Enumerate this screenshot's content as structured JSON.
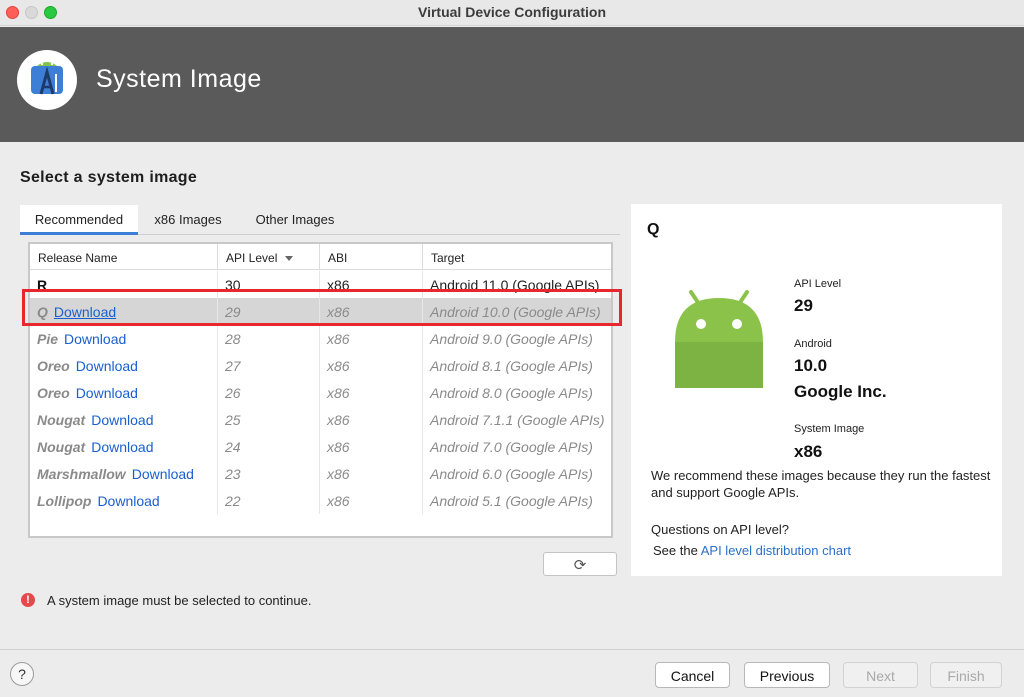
{
  "window": {
    "title": "Virtual Device Configuration"
  },
  "header": {
    "title": "System Image",
    "logo_icon": "android-studio-icon"
  },
  "section": {
    "title": "Select a system image"
  },
  "tabs": [
    {
      "label": "Recommended",
      "active": true
    },
    {
      "label": "x86 Images",
      "active": false
    },
    {
      "label": "Other Images",
      "active": false
    }
  ],
  "table": {
    "columns": [
      "Release Name",
      "API Level",
      "ABI",
      "Target"
    ],
    "sort_column": "API Level",
    "rows": [
      {
        "name": "R",
        "download": "",
        "api": "30",
        "abi": "x86",
        "target": "Android 11.0 (Google APIs)",
        "installed": true,
        "selected": false
      },
      {
        "name": "Q",
        "download": "Download",
        "api": "29",
        "abi": "x86",
        "target": "Android 10.0 (Google APIs)",
        "installed": false,
        "selected": true
      },
      {
        "name": "Pie",
        "download": "Download",
        "api": "28",
        "abi": "x86",
        "target": "Android 9.0 (Google APIs)",
        "installed": false,
        "selected": false
      },
      {
        "name": "Oreo",
        "download": "Download",
        "api": "27",
        "abi": "x86",
        "target": "Android 8.1 (Google APIs)",
        "installed": false,
        "selected": false
      },
      {
        "name": "Oreo",
        "download": "Download",
        "api": "26",
        "abi": "x86",
        "target": "Android 8.0 (Google APIs)",
        "installed": false,
        "selected": false
      },
      {
        "name": "Nougat",
        "download": "Download",
        "api": "25",
        "abi": "x86",
        "target": "Android 7.1.1 (Google APIs)",
        "installed": false,
        "selected": false
      },
      {
        "name": "Nougat",
        "download": "Download",
        "api": "24",
        "abi": "x86",
        "target": "Android 7.0 (Google APIs)",
        "installed": false,
        "selected": false
      },
      {
        "name": "Marshmallow",
        "download": "Download",
        "api": "23",
        "abi": "x86",
        "target": "Android 6.0 (Google APIs)",
        "installed": false,
        "selected": false
      },
      {
        "name": "Lollipop",
        "download": "Download",
        "api": "22",
        "abi": "x86",
        "target": "Android 5.1 (Google APIs)",
        "installed": false,
        "selected": false
      }
    ]
  },
  "refresh": {
    "icon": "refresh-icon",
    "glyph": "⟳"
  },
  "error": {
    "message": "A system image must be selected to continue.",
    "icon_glyph": "!"
  },
  "detail": {
    "title": "Q",
    "api_level_label": "API Level",
    "api_level_value": "29",
    "android_label": "Android",
    "android_version": "10.0",
    "vendor": "Google Inc.",
    "system_image_label": "System Image",
    "system_image_value": "x86",
    "recommendation": "We recommend these images because they run the fastest and support Google APIs.",
    "question": "Questions on API level?",
    "see_prefix": "See the",
    "chart_link": "API level distribution chart"
  },
  "footer": {
    "help": "?",
    "cancel": "Cancel",
    "previous": "Previous",
    "next": "Next",
    "finish": "Finish"
  },
  "colors": {
    "header_bg": "#5a5a5a",
    "link": "#1a5fd0",
    "highlight": "#e8262b",
    "android_green": "#8bc34a",
    "error": "#e5484d"
  }
}
